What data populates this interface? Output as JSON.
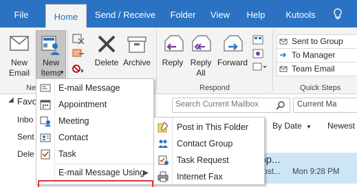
{
  "tabs": {
    "file": "File",
    "home": "Home",
    "send_receive": "Send / Receive",
    "folder": "Folder",
    "view": "View",
    "help": "Help",
    "kutools": "Kutools"
  },
  "ribbon": {
    "new_email_1": "New",
    "new_email_2": "Email",
    "new_items_1": "New",
    "new_items_2": "Items",
    "new_group_label": "Ne",
    "delete": "Delete",
    "archive": "Archive",
    "reply": "Reply",
    "reply_all_1": "Reply",
    "reply_all_2": "All",
    "forward": "Forward",
    "respond_label": "Respond",
    "quick_steps_label": "Quick Steps",
    "quick_steps": [
      "Sent to Group",
      "To Manager",
      "Team Email"
    ]
  },
  "nav": {
    "favorites": "Favo",
    "items": [
      "Inbo",
      "Sent",
      "Dele"
    ]
  },
  "search": {
    "placeholder": "Search Current Mailbox",
    "scope": "Current Ma"
  },
  "list": {
    "by_date": "By Date",
    "newest": "Newest",
    "preview_subject": "upp...",
    "preview_text": "t post...",
    "preview_time": "Mon 9:28 PM"
  },
  "new_items_menu": {
    "email_message": "E-mail Message",
    "appointment": "Appointment",
    "meeting": "Meeting",
    "contact": "Contact",
    "task": "Task",
    "email_using": "E-mail Message Using"
  },
  "more_items_menu": {
    "post_in_folder": "Post in This Folder",
    "contact_group": "Contact Group",
    "task_request": "Task Request",
    "internet_fax": "Internet Fax"
  },
  "colors": {
    "accent": "#2b72c2",
    "highlight": "#cde6f7",
    "red_box": "#d9363e"
  }
}
